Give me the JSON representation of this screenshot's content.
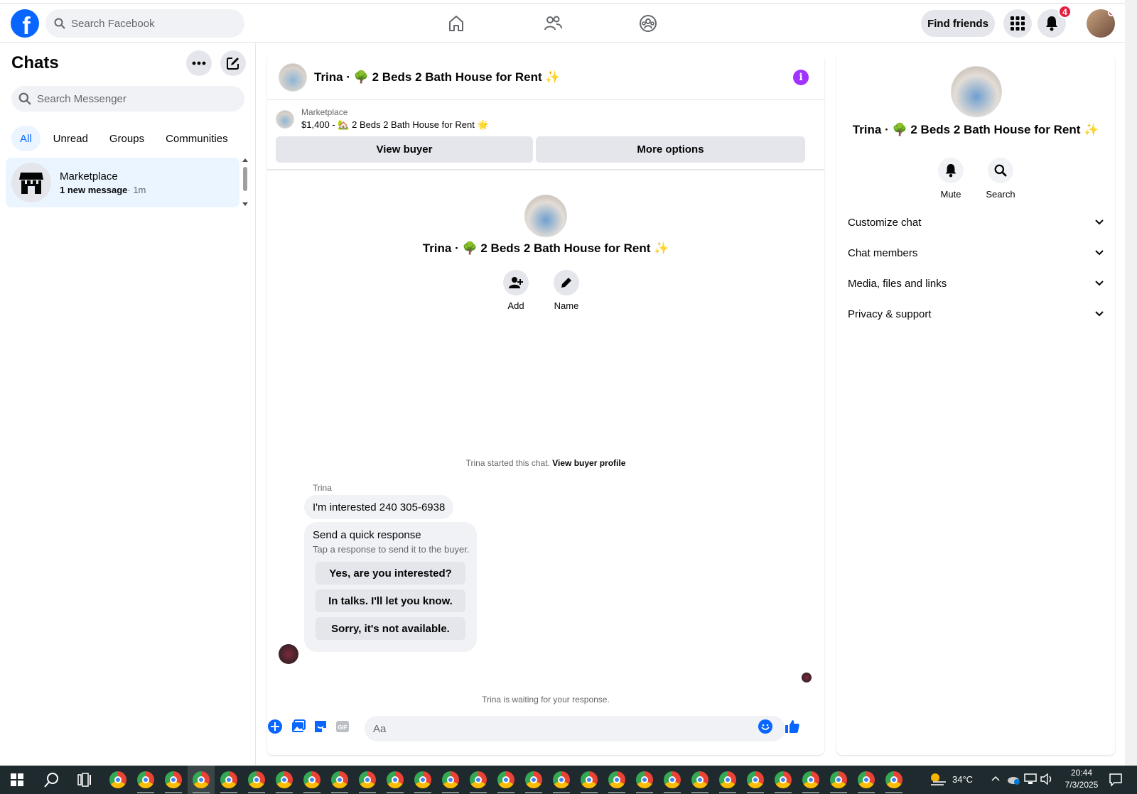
{
  "topnav": {
    "search_placeholder": "Search Facebook",
    "find_friends": "Find friends",
    "notifications_count": "4",
    "icons": [
      "home-icon",
      "friends-icon",
      "groups-icon",
      "apps-grid-icon",
      "bell-icon"
    ]
  },
  "left": {
    "title": "Chats",
    "search_placeholder": "Search Messenger",
    "filters": [
      "All",
      "Unread",
      "Groups",
      "Communities"
    ],
    "active_filter": "All",
    "chat_item": {
      "name": "Marketplace",
      "preview": "1 new message",
      "time": "· 1m"
    }
  },
  "center": {
    "header_title": "Trina · 🌳 2 Beds 2 Bath House for Rent ✨",
    "marketplace_label": "Marketplace",
    "listing": "$1,400 - 🏡 2 Beds 2 Bath House for Rent 🌟",
    "view_buyer": "View buyer",
    "more_options": "More options",
    "convo_title": "Trina · 🌳 2 Beds 2 Bath House for Rent ✨",
    "actions": [
      {
        "label": "Add"
      },
      {
        "label": "Name"
      }
    ],
    "started_text": "Trina started this chat.",
    "view_buyer_profile": "View buyer profile",
    "sender": "Trina",
    "message": "I'm interested 240 305-6938",
    "quick_title": "Send a quick response",
    "quick_sub": "Tap a response to send it to the buyer.",
    "quick_replies": [
      "Yes, are you interested?",
      "In talks. I'll let you know.",
      "Sorry, it's not available."
    ],
    "waiting": "Trina is waiting for your response.",
    "composer_placeholder": "Aa"
  },
  "right": {
    "title": "Trina · 🌳 2 Beds 2 Bath House for Rent ✨",
    "actions": [
      {
        "label": "Mute"
      },
      {
        "label": "Search"
      }
    ],
    "sections": [
      "Customize chat",
      "Chat members",
      "Media, files and links",
      "Privacy & support"
    ]
  },
  "taskbar": {
    "weather": "34°C",
    "time": "20:44",
    "date": "7/3/2025"
  },
  "colors": {
    "accent": "#0866ff",
    "chat_selected": "#ebf5ff",
    "info": "#a033ff",
    "badge": "#e41e3f"
  }
}
